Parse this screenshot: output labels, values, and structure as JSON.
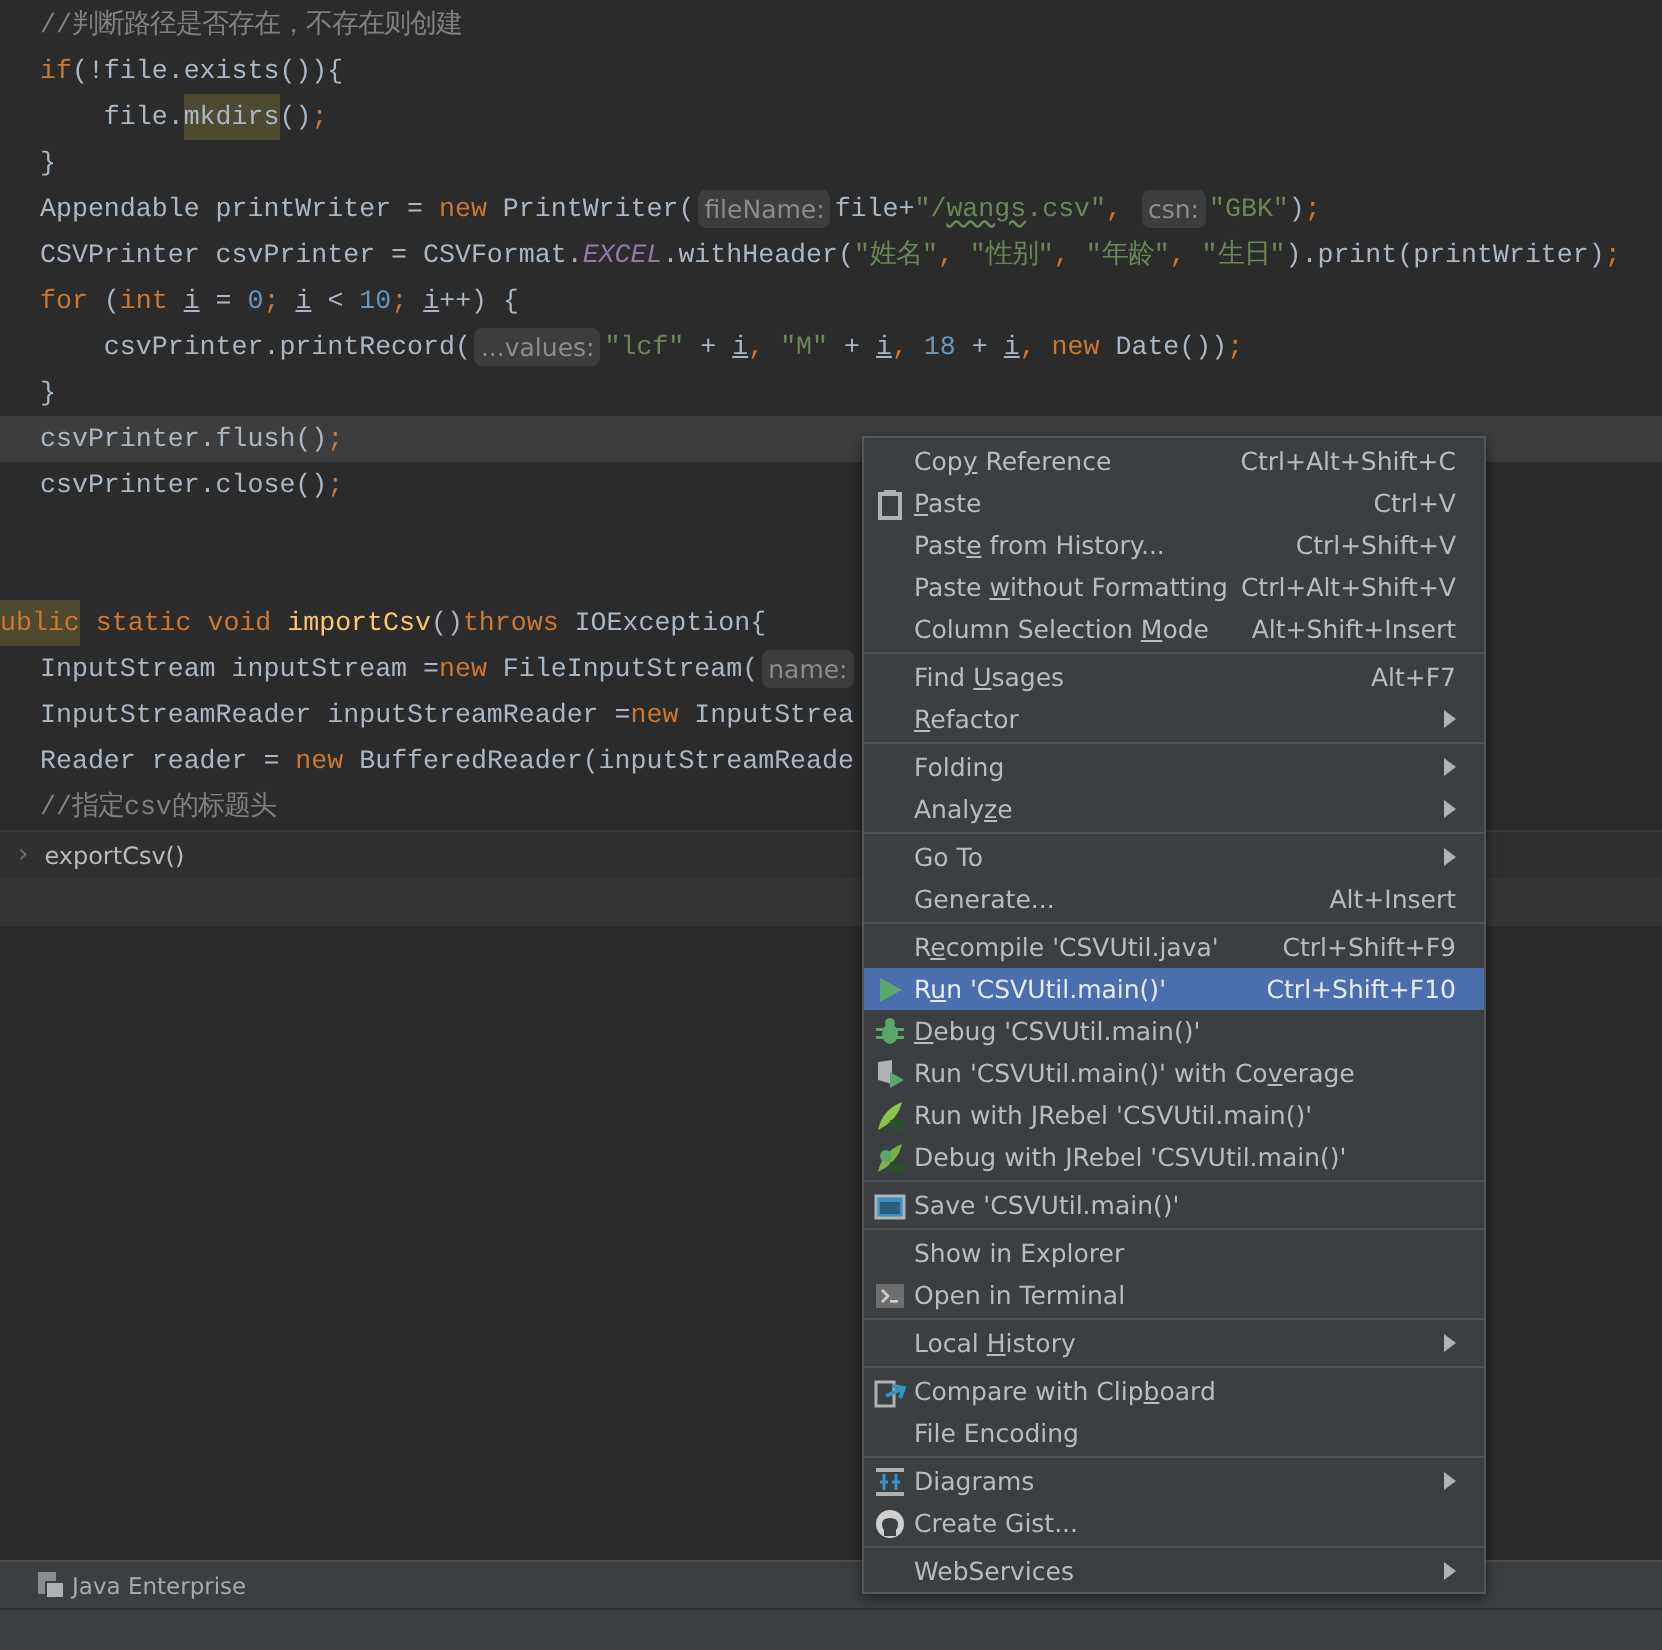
{
  "editor": {
    "lines": [
      {
        "caret": false,
        "cut_left": false,
        "tokens": [
          {
            "kind": "comment",
            "text": "//判断路径是否存在，不存在则创建"
          }
        ]
      },
      {
        "caret": false,
        "cut_left": false,
        "tokens": [
          {
            "kind": "keyword",
            "text": "if"
          },
          {
            "kind": "plain",
            "text": "(!file.exists()){"
          }
        ]
      },
      {
        "caret": false,
        "cut_left": false,
        "tokens": [
          {
            "kind": "plain",
            "text": "    file."
          },
          {
            "kind": "highlight",
            "text": "mkdirs"
          },
          {
            "kind": "plain",
            "text": "()"
          },
          {
            "kind": "punct",
            "text": ";"
          }
        ]
      },
      {
        "caret": false,
        "cut_left": false,
        "tokens": [
          {
            "kind": "plain",
            "text": "}"
          }
        ]
      },
      {
        "caret": false,
        "cut_left": false,
        "tokens": [
          {
            "kind": "plain",
            "text": "Appendable printWriter = "
          },
          {
            "kind": "keyword",
            "text": "new"
          },
          {
            "kind": "plain",
            "text": " PrintWriter("
          },
          {
            "kind": "hint",
            "text": "fileName:"
          },
          {
            "kind": "plain",
            "text": "file+"
          },
          {
            "kind": "string",
            "text": "\"/"
          },
          {
            "kind": "typo",
            "text": "wangs"
          },
          {
            "kind": "string",
            "text": ".csv\""
          },
          {
            "kind": "punct",
            "text": ", "
          },
          {
            "kind": "hint",
            "text": "csn:"
          },
          {
            "kind": "string",
            "text": "\"GBK\""
          },
          {
            "kind": "plain",
            "text": ")"
          },
          {
            "kind": "punct",
            "text": ";"
          }
        ]
      },
      {
        "caret": false,
        "cut_left": false,
        "tokens": [
          {
            "kind": "plain",
            "text": "CSVPrinter csvPrinter = CSVFormat."
          },
          {
            "kind": "constant",
            "text": "EXCEL"
          },
          {
            "kind": "plain",
            "text": ".withHeader("
          },
          {
            "kind": "string",
            "text": "\"姓名\""
          },
          {
            "kind": "punct",
            "text": ", "
          },
          {
            "kind": "string",
            "text": "\"性别\""
          },
          {
            "kind": "punct",
            "text": ", "
          },
          {
            "kind": "string",
            "text": "\"年龄\""
          },
          {
            "kind": "punct",
            "text": ", "
          },
          {
            "kind": "string",
            "text": "\"生日\""
          },
          {
            "kind": "plain",
            "text": ").print(printWriter)"
          },
          {
            "kind": "punct",
            "text": ";"
          }
        ]
      },
      {
        "caret": false,
        "cut_left": false,
        "tokens": [
          {
            "kind": "keyword",
            "text": "for"
          },
          {
            "kind": "plain",
            "text": " ("
          },
          {
            "kind": "keyword",
            "text": "int "
          },
          {
            "kind": "variable",
            "text": "i"
          },
          {
            "kind": "plain",
            "text": " = "
          },
          {
            "kind": "number",
            "text": "0"
          },
          {
            "kind": "punct",
            "text": "; "
          },
          {
            "kind": "variable",
            "text": "i"
          },
          {
            "kind": "plain",
            "text": " < "
          },
          {
            "kind": "number",
            "text": "10"
          },
          {
            "kind": "punct",
            "text": "; "
          },
          {
            "kind": "variable",
            "text": "i"
          },
          {
            "kind": "plain",
            "text": "++) {"
          }
        ]
      },
      {
        "caret": false,
        "cut_left": false,
        "tokens": [
          {
            "kind": "plain",
            "text": "    csvPrinter.printRecord("
          },
          {
            "kind": "hint",
            "text": "...values:"
          },
          {
            "kind": "string",
            "text": "\"lcf\""
          },
          {
            "kind": "plain",
            "text": " + "
          },
          {
            "kind": "variable",
            "text": "i"
          },
          {
            "kind": "punct",
            "text": ", "
          },
          {
            "kind": "string",
            "text": "\"M\""
          },
          {
            "kind": "plain",
            "text": " + "
          },
          {
            "kind": "variable",
            "text": "i"
          },
          {
            "kind": "punct",
            "text": ", "
          },
          {
            "kind": "number",
            "text": "18"
          },
          {
            "kind": "plain",
            "text": " + "
          },
          {
            "kind": "variable",
            "text": "i"
          },
          {
            "kind": "punct",
            "text": ", "
          },
          {
            "kind": "keyword",
            "text": "new"
          },
          {
            "kind": "plain",
            "text": " Date())"
          },
          {
            "kind": "punct",
            "text": ";"
          }
        ]
      },
      {
        "caret": false,
        "cut_left": false,
        "tokens": [
          {
            "kind": "plain",
            "text": "}"
          }
        ]
      },
      {
        "caret": true,
        "cut_left": false,
        "tokens": [
          {
            "kind": "plain",
            "text": "csvPrinter.flush()"
          },
          {
            "kind": "punct",
            "text": ";"
          }
        ]
      },
      {
        "caret": false,
        "cut_left": false,
        "tokens": [
          {
            "kind": "plain",
            "text": "csvPrinter.close()"
          },
          {
            "kind": "punct",
            "text": ";"
          }
        ]
      },
      {
        "caret": false
      },
      {
        "caret": false
      },
      {
        "caret": false,
        "cut_left": true,
        "tokens": [
          {
            "kind": "keyword-highlight",
            "text": "ublic"
          },
          {
            "kind": "keyword",
            "text": " static void "
          },
          {
            "kind": "method",
            "text": "importCsv"
          },
          {
            "kind": "plain",
            "text": "()"
          },
          {
            "kind": "keyword",
            "text": "throws"
          },
          {
            "kind": "plain",
            "text": " IOException{"
          }
        ]
      },
      {
        "caret": false,
        "cut_left": false,
        "tokens": [
          {
            "kind": "plain",
            "text": "InputStream inputStream ="
          },
          {
            "kind": "keyword",
            "text": "new"
          },
          {
            "kind": "plain",
            "text": " FileInputStream("
          },
          {
            "kind": "hint",
            "text": "name:"
          }
        ]
      },
      {
        "caret": false,
        "cut_left": false,
        "tokens": [
          {
            "kind": "plain",
            "text": "InputStreamReader inputStreamReader ="
          },
          {
            "kind": "keyword",
            "text": "new"
          },
          {
            "kind": "plain",
            "text": " InputStrea"
          }
        ]
      },
      {
        "caret": false,
        "cut_left": false,
        "tokens": [
          {
            "kind": "plain",
            "text": "Reader reader = "
          },
          {
            "kind": "keyword",
            "text": "new"
          },
          {
            "kind": "plain",
            "text": " BufferedReader(inputStreamReade"
          }
        ]
      },
      {
        "caret": false,
        "cut_left": false,
        "tokens": [
          {
            "kind": "comment",
            "text": "//指定csv的标题头"
          }
        ]
      }
    ]
  },
  "breadcrumb": {
    "chevron": "›",
    "label": "exportCsv()"
  },
  "tool_window_bar": {
    "label": "Java Enterprise"
  },
  "context_menu": {
    "groups": [
      [
        {
          "before": "Cop",
          "key": "y",
          "after": " Reference",
          "shortcut": "Ctrl+Alt+Shift+C",
          "submenu": false,
          "selected": false
        },
        {
          "kind": "paste",
          "key": "P",
          "after": "aste",
          "shortcut": "Ctrl+V",
          "submenu": false,
          "selected": false
        },
        {
          "before": "Past",
          "key": "e",
          "after": " from History...",
          "shortcut": "Ctrl+Shift+V",
          "submenu": false,
          "selected": false
        },
        {
          "before": "Paste ",
          "key": "w",
          "after": "ithout Formatting",
          "shortcut": "Ctrl+Alt+Shift+V",
          "submenu": false,
          "selected": false
        },
        {
          "before": "Column Selection ",
          "key": "M",
          "after": "ode",
          "shortcut": "Alt+Shift+Insert",
          "submenu": false,
          "selected": false
        }
      ],
      [
        {
          "before": "Find ",
          "key": "U",
          "after": "sages",
          "shortcut": "Alt+F7",
          "submenu": false,
          "selected": false
        },
        {
          "key": "R",
          "after": "efactor",
          "submenu": true,
          "selected": false
        }
      ],
      [
        {
          "before": "Folding",
          "submenu": true,
          "selected": false
        },
        {
          "before": "Analy",
          "key": "z",
          "after": "e",
          "submenu": true,
          "selected": false
        }
      ],
      [
        {
          "before": "Go To",
          "submenu": true,
          "selected": false
        },
        {
          "before": "Generate...",
          "shortcut": "Alt+Insert",
          "submenu": false,
          "selected": false
        }
      ],
      [
        {
          "before": "R",
          "key": "e",
          "after": "compile 'CSVUtil.java'",
          "shortcut": "Ctrl+Shift+F9",
          "submenu": false,
          "selected": false
        },
        {
          "kind": "run",
          "before": "R",
          "key": "u",
          "after": "n 'CSVUtil.main()'",
          "shortcut": "Ctrl+Shift+F10",
          "submenu": false,
          "selected": true
        },
        {
          "kind": "debug",
          "key": "D",
          "after": "ebug 'CSVUtil.main()'",
          "submenu": false,
          "selected": false
        },
        {
          "kind": "coverage",
          "before": "Run 'CSVUtil.main()' with Co",
          "key": "v",
          "after": "erage",
          "submenu": false,
          "selected": false
        },
        {
          "kind": "jrebel-run",
          "before": "Run with JRebel 'CSVUtil.main()'",
          "submenu": false,
          "selected": false
        },
        {
          "kind": "jrebel-debug",
          "before": "Debug with JRebel 'CSVUtil.main()'",
          "submenu": false,
          "selected": false
        }
      ],
      [
        {
          "kind": "save",
          "before": "Save 'CSVUtil.main()'",
          "submenu": false,
          "selected": false
        }
      ],
      [
        {
          "before": "Show in Explorer",
          "submenu": false,
          "selected": false
        },
        {
          "kind": "terminal",
          "before": "Open in Terminal",
          "submenu": false,
          "selected": false
        }
      ],
      [
        {
          "before": "Local ",
          "key": "H",
          "after": "istory",
          "submenu": true,
          "selected": false
        }
      ],
      [
        {
          "kind": "compare",
          "before": "Compare with Clip",
          "key": "b",
          "after": "oard",
          "submenu": false,
          "selected": false
        },
        {
          "before": "File Encoding",
          "submenu": false,
          "selected": false
        }
      ],
      [
        {
          "kind": "diagrams",
          "before": "Diagrams",
          "submenu": true,
          "selected": false
        },
        {
          "kind": "github",
          "before": "Create Gist...",
          "submenu": false,
          "selected": false
        }
      ],
      [
        {
          "before": "WebServices",
          "submenu": true,
          "selected": false
        }
      ]
    ]
  }
}
